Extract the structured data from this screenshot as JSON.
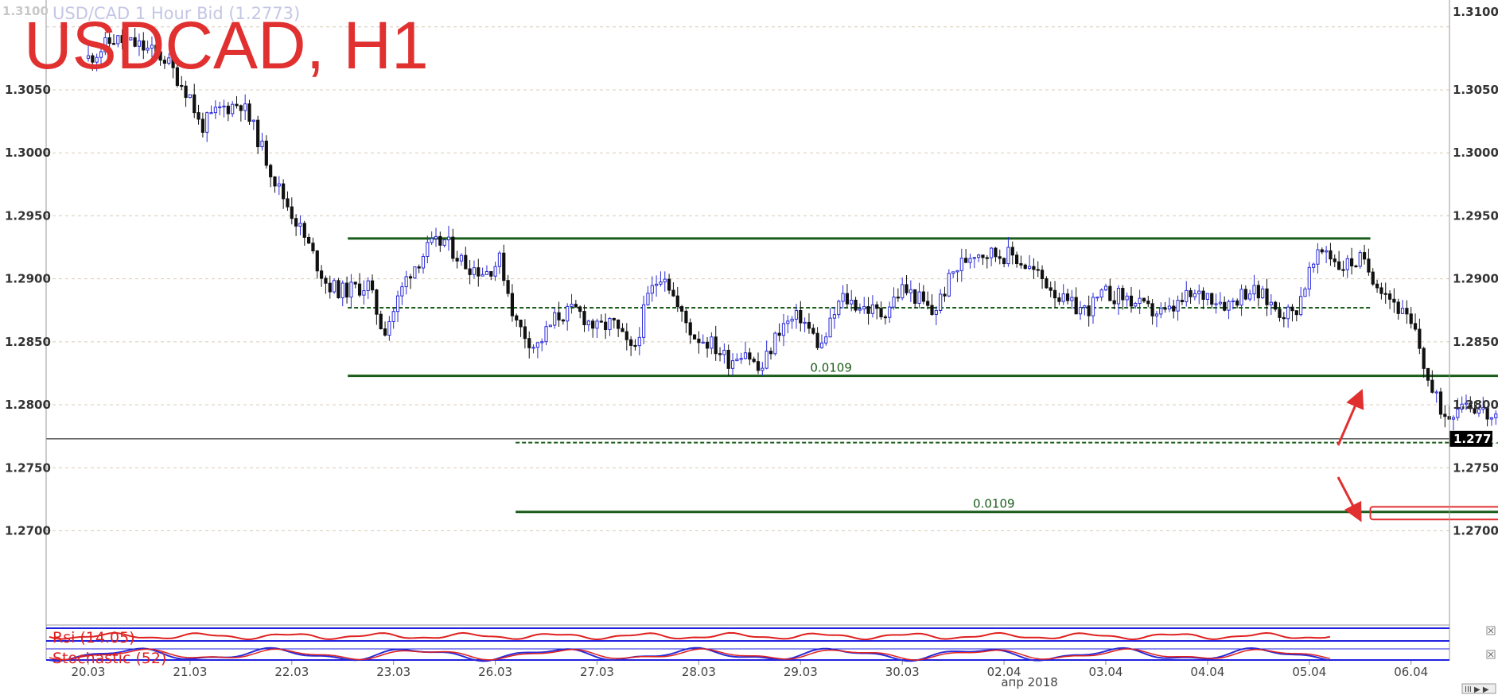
{
  "header": {
    "title": "USDCAD, H1",
    "subtitle": "USD/CAD 1 Hour Bid (1.2773)",
    "corner_value": "1.3100"
  },
  "colors": {
    "title": "#e03030",
    "subtitle": "#c4c6e6",
    "bull_candle": "#2a2ad8",
    "bear_candle": "#111111",
    "levels": "#1a5c1a",
    "rsi_line": "#e02020",
    "stoch_k": "#2a2ad8",
    "stoch_d": "#e02020",
    "price_line": "#000000",
    "grid": "#d8ccb8",
    "arrows": "#e03030"
  },
  "chart_data": {
    "type": "candlestick",
    "ylim": [
      1.267,
      1.3115
    ],
    "y_ticks": [
      1.27,
      1.275,
      1.28,
      1.285,
      1.29,
      1.295,
      1.3,
      1.305,
      1.31
    ],
    "y_tick_labels": [
      "1.2700",
      "1.2750",
      "1.2800",
      "1.2850",
      "1.2900",
      "1.2950",
      "1.3000",
      "1.3050",
      "1.3100"
    ],
    "x_ticks": [
      "20.03",
      "21.03",
      "22.03",
      "23.03",
      "26.03",
      "27.03",
      "28.03",
      "29.03",
      "30.03",
      "02.04",
      "03.04",
      "04.04",
      "05.04",
      "06.04"
    ],
    "x_sublabel": "апр 2018",
    "current_price": 1.2773,
    "current_price_label": "1.2773",
    "path": [
      [
        0,
        1.3075
      ],
      [
        0.25,
        1.309
      ],
      [
        0.5,
        1.3085
      ],
      [
        0.75,
        1.3075
      ],
      [
        1,
        1.3045
      ],
      [
        1.1,
        1.302
      ],
      [
        1.3,
        1.3035
      ],
      [
        1.5,
        1.304
      ],
      [
        1.65,
        1.3015
      ],
      [
        1.85,
        1.2975
      ],
      [
        2.05,
        1.2945
      ],
      [
        2.2,
        1.292
      ],
      [
        2.35,
        1.2895
      ],
      [
        2.5,
        1.289
      ],
      [
        2.75,
        1.2895
      ],
      [
        2.9,
        1.2858
      ],
      [
        3.0,
        1.2875
      ],
      [
        3.15,
        1.2905
      ],
      [
        3.35,
        1.2925
      ],
      [
        3.5,
        1.293
      ],
      [
        3.7,
        1.2912
      ],
      [
        3.9,
        1.2905
      ],
      [
        4.05,
        1.2915
      ],
      [
        4.2,
        1.2865
      ],
      [
        4.4,
        1.2845
      ],
      [
        4.6,
        1.287
      ],
      [
        4.8,
        1.2875
      ],
      [
        5.0,
        1.286
      ],
      [
        5.15,
        1.2865
      ],
      [
        5.35,
        1.284
      ],
      [
        5.5,
        1.2885
      ],
      [
        5.65,
        1.2908
      ],
      [
        5.8,
        1.2875
      ],
      [
        5.95,
        1.2855
      ],
      [
        6.1,
        1.285
      ],
      [
        6.3,
        1.2835
      ],
      [
        6.45,
        1.2845
      ],
      [
        6.6,
        1.2825
      ],
      [
        6.8,
        1.2862
      ],
      [
        7.0,
        1.287
      ],
      [
        7.2,
        1.2845
      ],
      [
        7.4,
        1.2885
      ],
      [
        7.6,
        1.2878
      ],
      [
        7.8,
        1.2872
      ],
      [
        8.0,
        1.2892
      ],
      [
        8.15,
        1.2885
      ],
      [
        8.3,
        1.2872
      ],
      [
        8.5,
        1.2905
      ],
      [
        8.7,
        1.2922
      ],
      [
        8.9,
        1.292
      ],
      [
        9.1,
        1.2918
      ],
      [
        9.3,
        1.2905
      ],
      [
        9.45,
        1.2895
      ],
      [
        9.6,
        1.288
      ],
      [
        9.8,
        1.2875
      ],
      [
        10.0,
        1.2888
      ],
      [
        10.2,
        1.2885
      ],
      [
        10.4,
        1.2875
      ],
      [
        10.6,
        1.2872
      ],
      [
        10.8,
        1.2885
      ],
      [
        11.0,
        1.2888
      ],
      [
        11.2,
        1.288
      ],
      [
        11.4,
        1.2892
      ],
      [
        11.55,
        1.2885
      ],
      [
        11.7,
        1.2875
      ],
      [
        11.85,
        1.2872
      ],
      [
        12.0,
        1.2905
      ],
      [
        12.15,
        1.2925
      ],
      [
        12.3,
        1.291
      ],
      [
        12.5,
        1.2915
      ],
      [
        12.7,
        1.2895
      ],
      [
        12.85,
        1.288
      ],
      [
        12.95,
        1.2868
      ],
      [
        13.05,
        1.2855
      ],
      [
        13.2,
        1.281
      ],
      [
        13.35,
        1.279
      ],
      [
        13.5,
        1.2805
      ],
      [
        13.7,
        1.2795
      ],
      [
        13.85,
        1.2785
      ],
      [
        14.0,
        1.2775
      ],
      [
        14.15,
        1.281
      ],
      [
        14.3,
        1.2828
      ],
      [
        14.45,
        1.2835
      ],
      [
        14.6,
        1.2818
      ],
      [
        14.75,
        1.2795
      ],
      [
        14.9,
        1.2768
      ],
      [
        15.05,
        1.2758
      ],
      [
        15.2,
        1.2755
      ],
      [
        15.35,
        1.2762
      ],
      [
        15.5,
        1.2772
      ],
      [
        15.65,
        1.2774
      ],
      [
        15.75,
        1.2773
      ]
    ],
    "levels": [
      {
        "y": 1.2932,
        "x_from": 2.55,
        "x_to": 12.6,
        "style": "solid"
      },
      {
        "y": 1.2877,
        "x_from": 2.55,
        "x_to": 12.6,
        "style": "dashed"
      },
      {
        "y": 1.2823,
        "x_from": 2.55,
        "x_to": 15.65,
        "style": "solid"
      },
      {
        "y": 1.277,
        "x_from": 4.2,
        "x_to": 15.65,
        "style": "dashed"
      },
      {
        "y": 1.2715,
        "x_from": 4.2,
        "x_to": 15.65,
        "style": "solid"
      }
    ],
    "annotations": [
      {
        "text": "0.0109",
        "x": 7.3,
        "y": 1.2825
      },
      {
        "text": "0.0109",
        "x": 8.9,
        "y": 1.2717
      }
    ],
    "target_box": {
      "x_from": 12.6,
      "x_to": 15.8,
      "y_from": 1.2709,
      "y_to": 1.2719
    },
    "indicators": [
      {
        "name": "Rsi (14.05)",
        "type": "rsi"
      },
      {
        "name": "Stochastic (52)",
        "type": "stochastic"
      }
    ]
  }
}
